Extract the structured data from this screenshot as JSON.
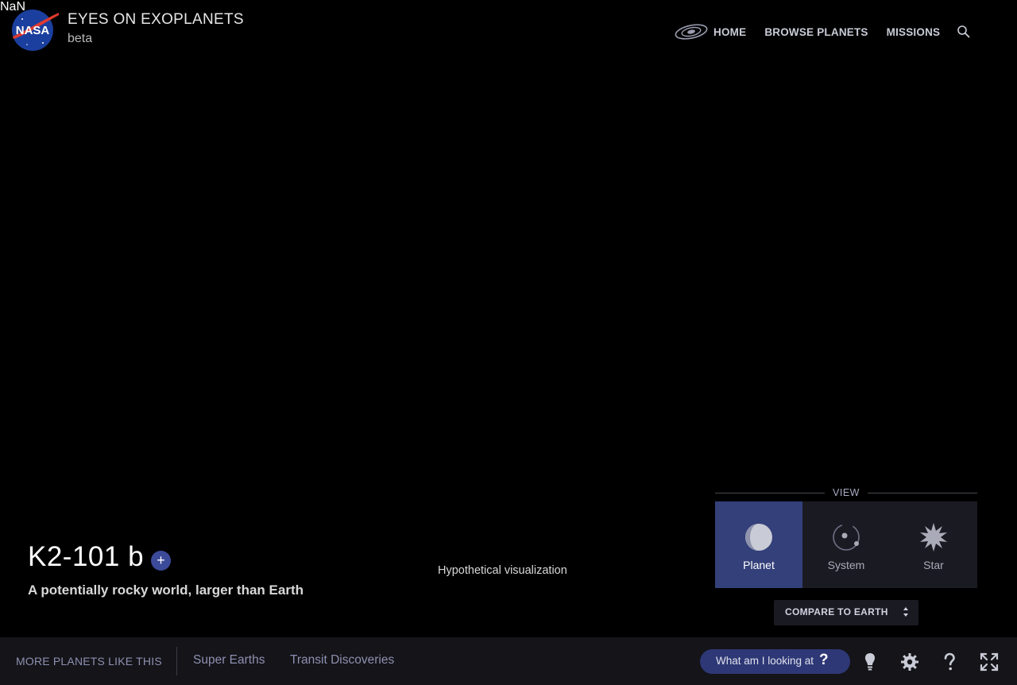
{
  "debug_text": "NaN",
  "header": {
    "title": "EYES ON EXOPLANETS",
    "subtitle": "beta",
    "logo_text": "NASA",
    "nav": [
      "HOME",
      "BROWSE PLANETS",
      "MISSIONS"
    ]
  },
  "planet": {
    "name": "K2-101 b",
    "add_label": "+",
    "description": "A potentially rocky world, larger than Earth"
  },
  "caption": "Hypothetical visualization",
  "view": {
    "heading": "VIEW",
    "options": [
      "Planet",
      "System",
      "Star"
    ],
    "active": "Planet"
  },
  "compare": {
    "label": "COMPARE TO EARTH"
  },
  "footer": {
    "more_label": "MORE PLANETS LIKE THIS",
    "categories": [
      "Super Earths",
      "Transit Discoveries"
    ],
    "help_button": "What am I looking at",
    "help_glyph": "?",
    "icons": [
      "lightbulb-icon",
      "settings-gear-icon",
      "help-icon",
      "fullscreen-icon"
    ]
  },
  "colors": {
    "background": "#000000",
    "accent": "#34407a",
    "bar": "#141419"
  }
}
